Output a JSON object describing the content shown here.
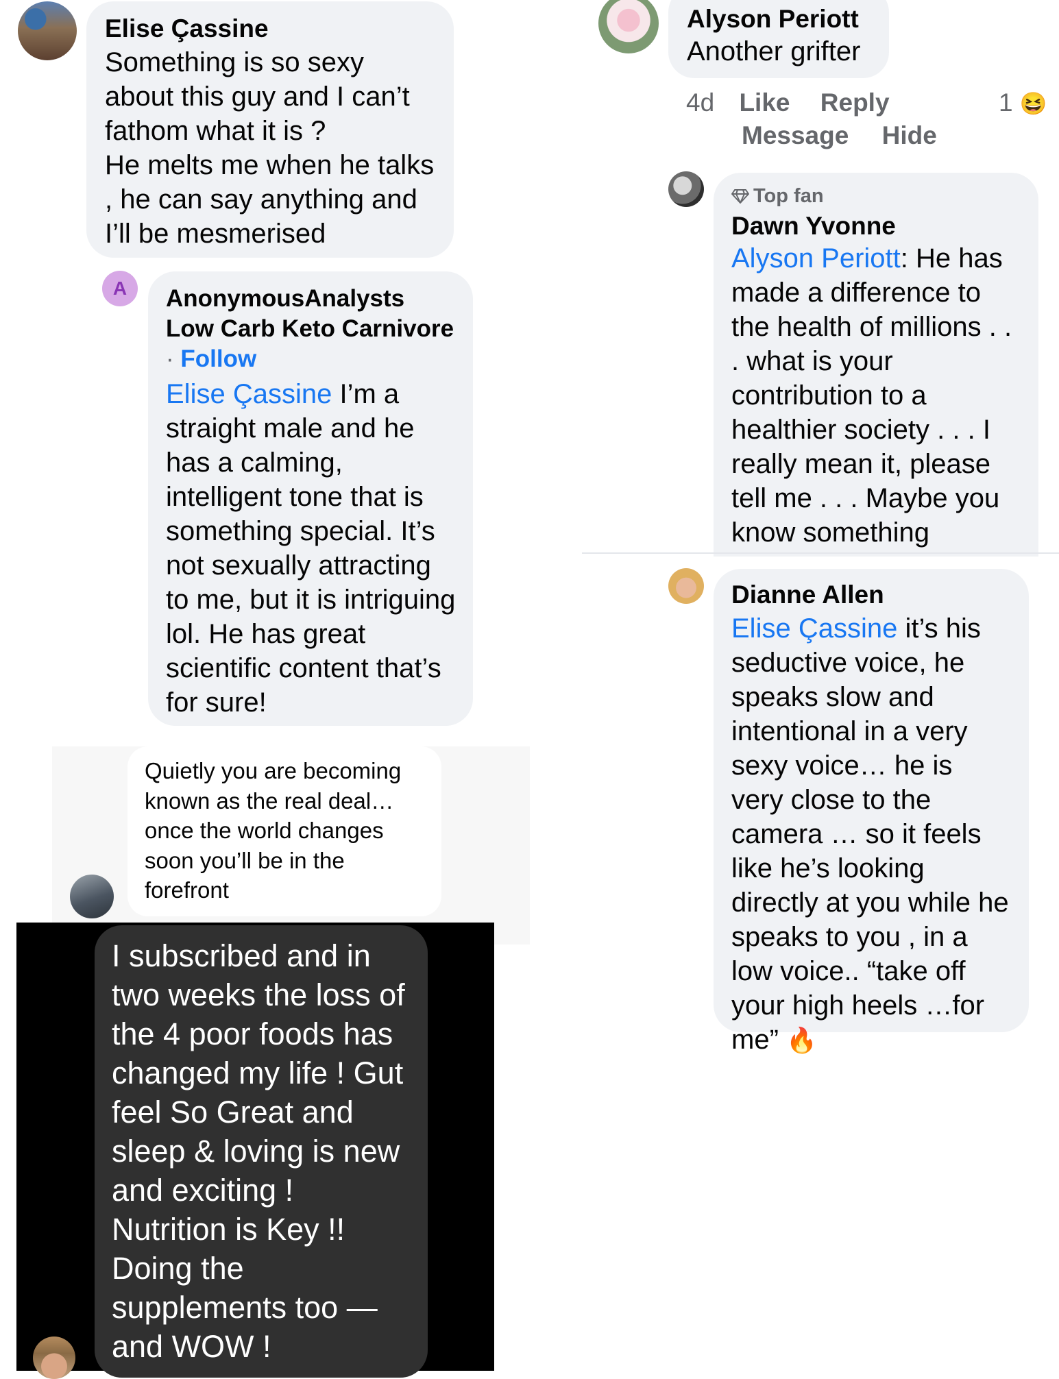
{
  "comments": {
    "elise": {
      "author": "Elise Çassine",
      "text": "Something is so sexy about this guy and I can’t fathom what it is ?\nHe melts me when he talks , he can say anything and I’ll be mesmerised"
    },
    "analyst": {
      "avatar_letter": "A",
      "author": "AnonymousAnalysts Low Carb Keto Carnivore",
      "separator": "·",
      "follow_label": "Follow",
      "mention": "Elise Çassine",
      "text": "I’m a straight male and he has a calming, intelligent tone that is something special. It’s not sexually attracting to me, but it is intriguing lol. He has great scientific content that’s for sure!"
    },
    "quietly": {
      "text": "Quietly you are becoming known as the real deal… once the world changes soon you’ll be in the forefront"
    },
    "subscribed": {
      "text": "I subscribed and in two weeks the loss of the 4 poor foods has changed my life ! Gut feel So Great and sleep & loving is new and exciting ! Nutrition is Key !! Doing the supplements too — and WOW !"
    },
    "alyson": {
      "author": "Alyson Periott",
      "text": "Another grifter",
      "time": "4d",
      "like_label": "Like",
      "reply_label": "Reply",
      "message_label": "Message",
      "hide_label": "Hide",
      "reaction_count": "1",
      "reaction_emoji": "😆"
    },
    "dawn": {
      "badge_icon": "diamond-icon",
      "badge": "Top fan",
      "author": "Dawn Yvonne",
      "mention": "Alyson Periott",
      "text": ": He has made a difference to the health of millions . . . what is your contribution to a healthier society . . . I really mean it, please tell me . . . Maybe you know something"
    },
    "dianne": {
      "author": "Dianne Allen",
      "mention": "Elise Çassine",
      "text": "it’s his seductive voice, he speaks slow and intentional in a very sexy voice… he is very close to the camera … so it feels like he’s looking directly at you while he speaks to you , in a low voice.. “take off your high heels …for me”",
      "emoji": "🔥"
    }
  },
  "colors": {
    "bubble": "#f0f2f5",
    "link": "#1877f2",
    "meta": "#65676b",
    "dark_panel": "#000000",
    "dark_bubble": "#303030"
  }
}
